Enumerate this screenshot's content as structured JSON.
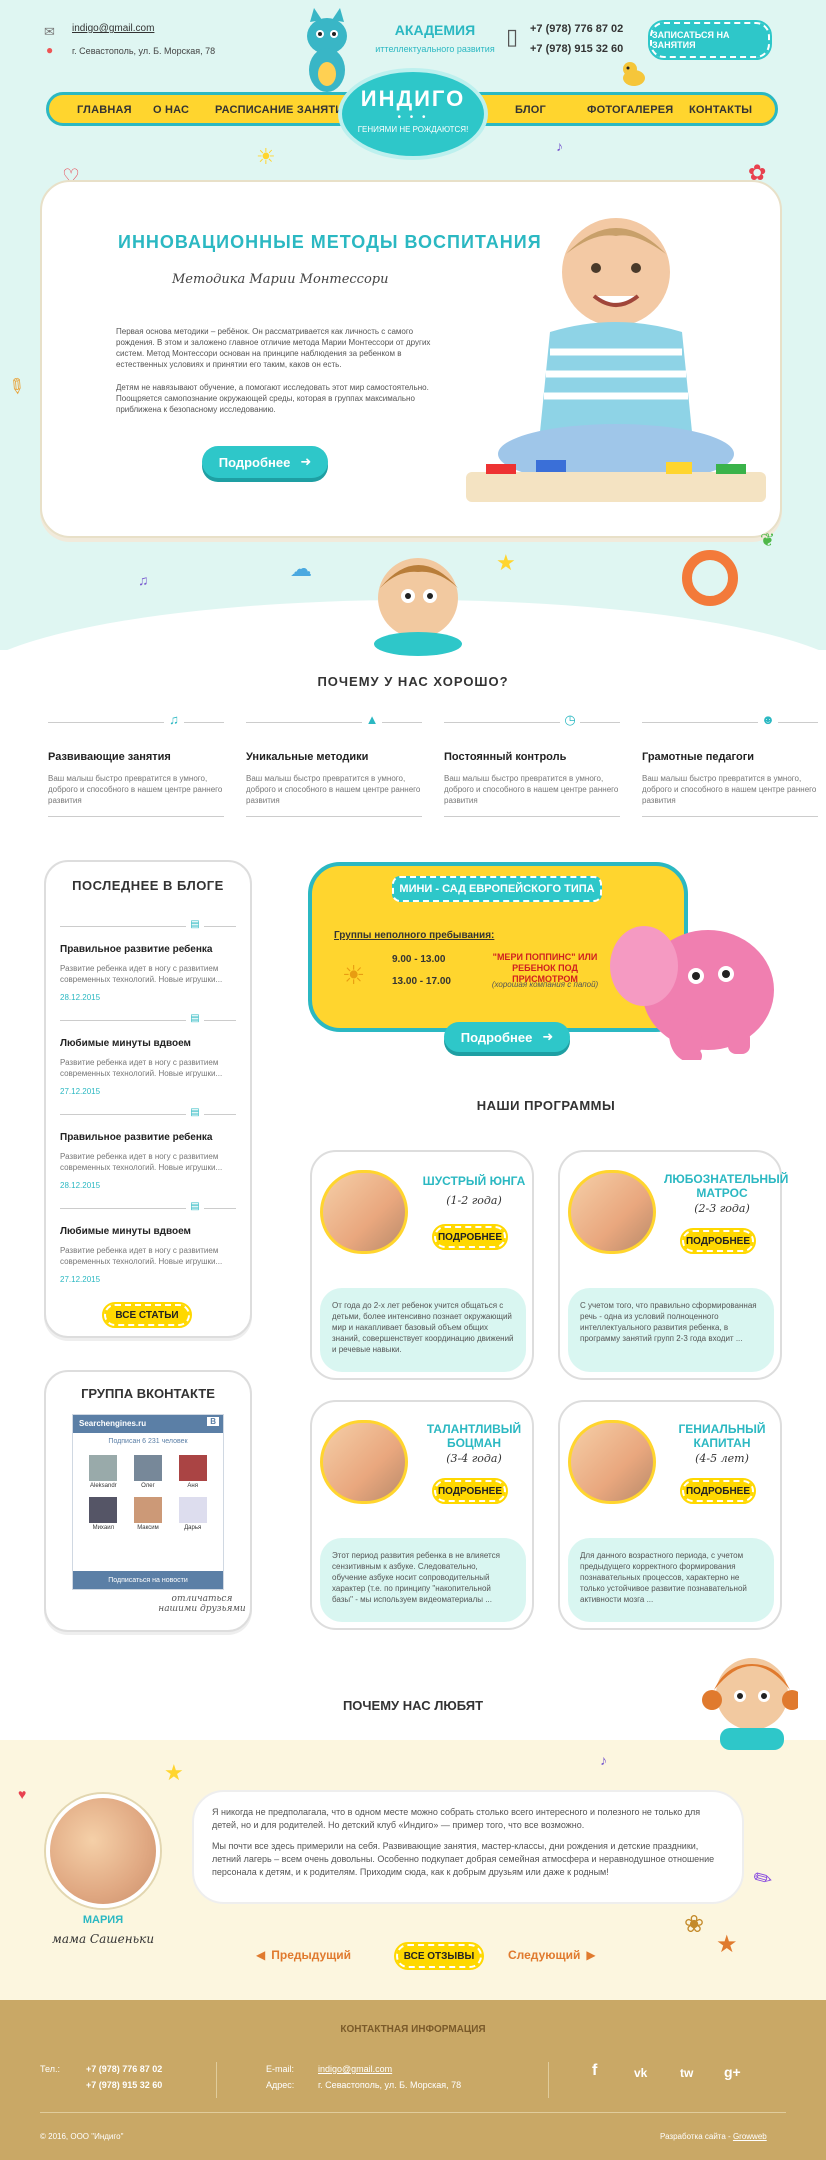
{
  "header": {
    "email": "indigo@gmail.com",
    "address": "г. Севастополь, ул. Б. Морская, 78",
    "academy_line1": "АКАДЕМИЯ",
    "academy_line2": "иттеллектуального развития",
    "phone1": "+7 (978) 776 87 02",
    "phone2": "+7 (978) 915 32 60",
    "signup_label": "ЗАПИСАТЬСЯ НА ЗАНЯТИЯ"
  },
  "nav": {
    "items": [
      "ГЛАВНАЯ",
      "О НАС",
      "РАСПИСАНИЕ ЗАНЯТИЙ",
      "БЛОГ",
      "ФОТОГАЛЕРЕЯ",
      "КОНТАКТЫ"
    ],
    "logo_title": "ИНДИГО",
    "logo_slogan": "ГЕНИЯМИ НЕ РОЖДАЮТСЯ!"
  },
  "hero": {
    "title": "ИННОВАЦИОННЫЕ МЕТОДЫ ВОСПИТАНИЯ",
    "subtitle": "Методика Марии Монтессори",
    "p1": "Первая основа методики – ребёнок. Он рассматривается как личность с самого рождения. В этом и заложено главное отличие метода Марии Монтессори от других систем. Метод Монтессори основан на принципе наблюдения за ребенком в естественных условиях и принятии его таким, каков он есть.",
    "p2": "Детям не навязывают обучение, а помогают исследовать этот мир самостоятельно. Поощряется самопознание окружающей среды, которая в группах максимально приближена к безопасному исследованию.",
    "button": "Подробнее"
  },
  "why": {
    "title": "ПОЧЕМУ У НАС ХОРОШО?",
    "items": [
      {
        "icon": "music-notes-icon",
        "title": "Развивающие занятия",
        "text": "Ваш малыш быстро превратится в умного, доброго и способного в нашем центре раннего развития"
      },
      {
        "icon": "graduation-cap-icon",
        "title": "Уникальные методики",
        "text": "Ваш малыш быстро превратится в умного, доброго и способного в нашем центре раннего развития"
      },
      {
        "icon": "clock-icon",
        "title": "Постоянный контроль",
        "text": "Ваш малыш быстро превратится в умного, доброго и способного в нашем центре раннего развития"
      },
      {
        "icon": "teacher-icon",
        "title": "Грамотные педагоги",
        "text": "Ваш малыш быстро превратится в умного, доброго и способного в нашем центре раннего развития"
      }
    ]
  },
  "blog": {
    "title": "ПОСЛЕДНЕЕ В БЛОГЕ",
    "posts": [
      {
        "title": "Правильное развитие ребенка",
        "text": "Развитие ребенка идет в ногу с развитием современных технологий. Новые игрушки...",
        "date": "28.12.2015"
      },
      {
        "title": "Любимые минуты вдвоем",
        "text": "Развитие ребенка идет в ногу с развитием современных технологий. Новые игрушки...",
        "date": "27.12.2015"
      },
      {
        "title": "Правильное развитие ребенка",
        "text": "Развитие ребенка идет в ногу с развитием современных технологий. Новые игрушки...",
        "date": "28.12.2015"
      },
      {
        "title": "Любимые минуты вдвоем",
        "text": "Развитие ребенка идет в ногу с развитием современных технологий. Новые игрушки...",
        "date": "27.12.2015"
      }
    ],
    "all_button": "ВСЕ СТАТЬИ"
  },
  "vk": {
    "title": "ГРУППА ВКОНТАКТЕ",
    "group_name": "Searchengines.ru",
    "subscribers": "Подписан 6 231 человек",
    "members": [
      "Aleksandr",
      "Олег",
      "Аня",
      "Михаил",
      "Максим",
      "Дарья"
    ],
    "subscribe": "Подписаться на новости",
    "note": "отличаться нашими друзьями"
  },
  "mini": {
    "title": "МИНИ - САД ЕВРОПЕЙСКОГО ТИПА",
    "groups_label": "Группы неполного пребывания:",
    "time1": "9.00 - 13.00",
    "time2": "13.00 - 17.00",
    "promo": "\"МЕРИ ПОППИНС\" ИЛИ РЕБЕНОК ПОД ПРИСМОТРОМ",
    "promo_sub": "(хорошая компания с папой)",
    "button": "Подробнее"
  },
  "programs": {
    "title": "НАШИ ПРОГРАММЫ",
    "items": [
      {
        "name": "ШУСТРЫЙ ЮНГА",
        "age": "(1-2 года)",
        "text": "От года до 2-х лет ребенок учится общаться с детьми, более интенсивно познает окружающий мир и накапливает базовый объем общих знаний, совершенствует координацию движений и речевые навыки."
      },
      {
        "name": "ЛЮБОЗНАТЕЛЬНЫЙ МАТРОС",
        "age": "(2-3 года)",
        "text": "С учетом того, что правильно сформированная речь - одна из условий полноценного интеллектуального развития ребенка, в программу занятий групп 2-3 года входит ..."
      },
      {
        "name": "ТАЛАНТЛИВЫЙ БОЦМАН",
        "age": "(3-4 года)",
        "text": "Этот период развития ребенка в не влияется сензитивным к азбуке. Следовательно, обучение азбуке носит сопроводительный характер (т.е. по принципу \"накопительной базы\" - мы используем видеоматериалы ..."
      },
      {
        "name": "ГЕНИАЛЬНЫЙ КАПИТАН",
        "age": "(4-5 лет)",
        "text": "Для данного возрастного периода, с учетом предыдущего корректного формирования познавательных процессов, характерно не только устойчивое развитие познавательной активности мозга ..."
      }
    ],
    "button": "ПОДРОБНЕЕ"
  },
  "reviews": {
    "title": "ПОЧЕМУ НАС ЛЮБЯТ",
    "p1": "Я никогда не предполагала, что в одном месте можно собрать столько всего интересного и полезного не только для детей, но и для родителей. Но детский клуб «Индиго» — пример того, что все возможно.",
    "p2": "Мы почти все здесь примерили на себя. Развивающие занятия, мастер-классы, дни рождения и детские праздники, летний лагерь – всем очень довольны. Особенно подкупает добрая семейная атмосфера и неравнодушное отношение персонала к детям, и к родителям. Приходим сюда, как к добрым друзьям или даже к родным!",
    "author": "МАРИЯ",
    "author_sub": "мама Сашеньки",
    "prev": "Предыдущий",
    "all": "ВСЕ ОТЗЫВЫ",
    "next": "Следующий"
  },
  "footer": {
    "title": "КОНТАКТНАЯ ИНФОРМАЦИЯ",
    "tel_label": "Тел.:",
    "phone1": "+7 (978) 776 87 02",
    "phone2": "+7 (978) 915 32 60",
    "email_label": "E-mail:",
    "email": "indigo@gmail.com",
    "address_label": "Адрес:",
    "address": "г. Севастополь, ул. Б. Морская, 78",
    "copyright": "© 2016, ООО \"Индиго\"",
    "dev_label": "Разработка сайта -",
    "dev_name": "Growweb",
    "social": [
      "f",
      "vk",
      "tw",
      "g+"
    ]
  },
  "colors": {
    "teal": "#2bb8c2",
    "yellow": "#ffd52e",
    "mint": "#dff6f2",
    "sand": "#c9a866"
  }
}
